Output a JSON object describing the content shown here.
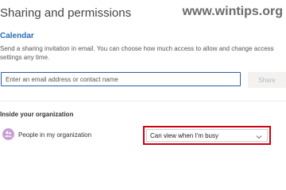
{
  "dialog": {
    "title": "Sharing and permissions",
    "watermark": "www.wintips.org"
  },
  "calendar": {
    "name": "Calendar",
    "description": "Send a sharing invitation in email. You can choose how much access to allow and change access settings any time."
  },
  "invite": {
    "placeholder": "Enter an email address or contact name",
    "share_label": "Share"
  },
  "organization": {
    "section_title": "Inside your organization",
    "person_name": "People in my organization",
    "permission_value": "Can view when I'm busy",
    "avatar_icon": "people-icon",
    "highlight_color": "#d00012"
  }
}
